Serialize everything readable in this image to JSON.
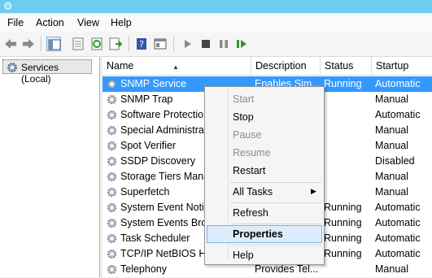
{
  "menu": [
    "File",
    "Action",
    "View",
    "Help"
  ],
  "tree": {
    "label": "Services (Local)"
  },
  "columns": {
    "name": "Name",
    "description": "Description",
    "status": "Status",
    "startup": "Startup Type"
  },
  "rows": [
    {
      "name": "SNMP Service",
      "description": "Enables Sim...",
      "status": "Running",
      "startup": "Automatic"
    },
    {
      "name": "SNMP Trap",
      "description": "",
      "status": "",
      "startup": "Manual"
    },
    {
      "name": "Software Protection",
      "description": "",
      "status": "",
      "startup": "Automatic"
    },
    {
      "name": "Special Administration",
      "description": "",
      "status": "",
      "startup": "Manual"
    },
    {
      "name": "Spot Verifier",
      "description": "",
      "status": "",
      "startup": "Manual"
    },
    {
      "name": "SSDP Discovery",
      "description": "",
      "status": "",
      "startup": "Disabled"
    },
    {
      "name": "Storage Tiers Management",
      "description": "",
      "status": "",
      "startup": "Manual"
    },
    {
      "name": "Superfetch",
      "description": "",
      "status": "",
      "startup": "Manual"
    },
    {
      "name": "System Event Notification",
      "description": "",
      "status": "Running",
      "startup": "Automatic"
    },
    {
      "name": "System Events Broker",
      "description": "",
      "status": "Running",
      "startup": "Automatic"
    },
    {
      "name": "Task Scheduler",
      "description": "",
      "status": "Running",
      "startup": "Automatic"
    },
    {
      "name": "TCP/IP NetBIOS Helper",
      "description": "",
      "status": "Running",
      "startup": "Automatic"
    },
    {
      "name": "Telephony",
      "description": "Provides Tel...",
      "status": "",
      "startup": "Manual"
    }
  ],
  "context_menu": {
    "start": "Start",
    "stop": "Stop",
    "pause": "Pause",
    "resume": "Resume",
    "restart": "Restart",
    "all_tasks": "All Tasks",
    "refresh": "Refresh",
    "properties": "Properties",
    "help": "Help"
  },
  "colors": {
    "titlebar": "#6ecdf0",
    "selection": "#3399ff",
    "menu_highlight": "#dcecfc"
  },
  "toolbar_icons": [
    "back-icon",
    "forward-icon",
    "show-hide-tree-icon",
    "properties-icon",
    "refresh-icon",
    "export-icon",
    "help-icon",
    "console-icon",
    "play-icon",
    "stop-icon",
    "pause-icon",
    "restart-icon"
  ]
}
